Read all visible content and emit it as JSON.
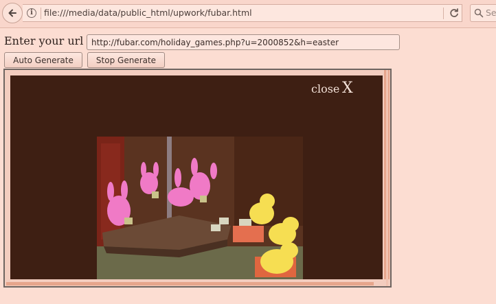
{
  "browser": {
    "url": "file:///media/data/public_html/upwork/fubar.html",
    "search_placeholder": "Se",
    "icons": {
      "back": "back-arrow-icon",
      "info": "info-icon",
      "reload": "reload-icon",
      "search": "search-icon"
    }
  },
  "form": {
    "label": "Enter your url",
    "url_value": "http://fubar.com/holiday_games.php?u=2000852&h=easter",
    "auto_button": "Auto Generate",
    "stop_button": "Stop Generate"
  },
  "popup": {
    "close_label": "close",
    "close_x": "X",
    "image": "peeps-easter-diorama"
  },
  "colors": {
    "page_bg": "#fcddd2",
    "popup_bg": "#3e1f13",
    "scrollbar": "#e6a58c"
  }
}
